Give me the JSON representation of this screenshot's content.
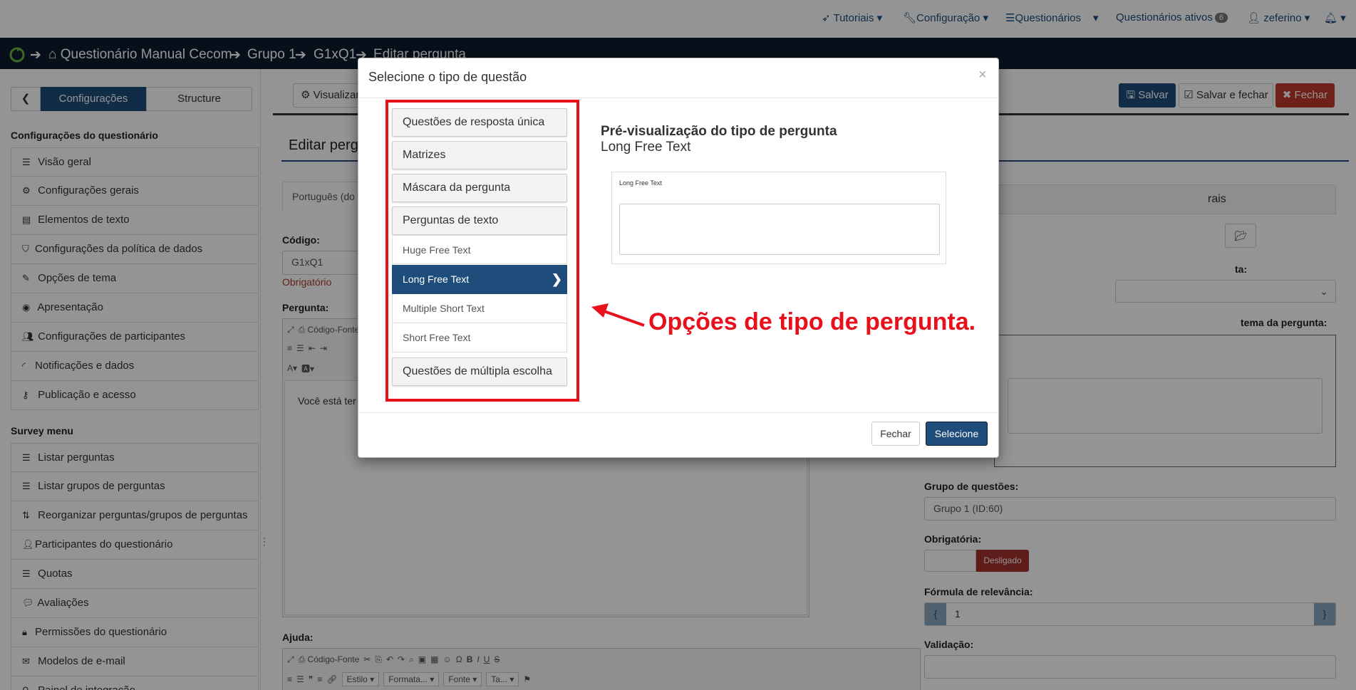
{
  "topnav": {
    "tutorials": "Tutoriais",
    "config": "Configuração",
    "questionnaires": "Questionários",
    "active": "Questionários ativos",
    "active_count": "6",
    "user": "zeferino"
  },
  "breadcrumb": {
    "survey": "Questionário Manual Cecom",
    "group": "Grupo 1",
    "question": "G1xQ1",
    "page": "Editar pergunta"
  },
  "sidebar": {
    "tab_settings": "Configurações",
    "tab_structure": "Structure",
    "section_settings": "Configurações do questionário",
    "items": [
      "Visão geral",
      "Configurações gerais",
      "Elementos de texto",
      "Configurações da política de dados",
      "Opções de tema",
      "Apresentação",
      "Configurações de participantes",
      "Notificações e dados",
      "Publicação e acesso"
    ],
    "section_menu": "Survey menu",
    "menu_items": [
      "Listar perguntas",
      "Listar grupos de perguntas",
      "Reorganizar perguntas/grupos de perguntas",
      "Participantes do questionário",
      "Quotas",
      "Avaliações",
      "Permissões do questionário",
      "Modelos de e-mail",
      "Painel de integração"
    ]
  },
  "main": {
    "preview_btn": "Visualizar",
    "save": "Salvar",
    "save_close": "Salvar e fechar",
    "close": "Fechar",
    "title": "Editar pergunta",
    "lang_tab": "Português (do",
    "code_label": "Código:",
    "code_value": "G1xQ1",
    "required_note": "Obrigatório",
    "question_label": "Pergunta:",
    "source_btn": "Código-Fonte",
    "question_text": "Você está ter",
    "help_label": "Ajuda:",
    "style_select": "Estilo",
    "format_select": "Formata...",
    "font_select": "Fonte",
    "size_select": "Ta...",
    "general_panel": "rais",
    "type_label": "ta:",
    "theme_label": "tema da pergunta:",
    "group_label": "Grupo de questões:",
    "group_value": "Grupo 1 (ID:60)",
    "mandatory_label": "Obrigatória:",
    "mandatory_value": "Desligado",
    "relevance_label": "Fórmula de relevância:",
    "relevance_open": "{",
    "relevance_value": "1",
    "relevance_close": "}",
    "validation_label": "Validação:"
  },
  "modal": {
    "title": "Selecione o tipo de questão",
    "close_x": "×",
    "groups": {
      "single": "Questões de resposta única",
      "matrices": "Matrizes",
      "mask": "Máscara da pergunta",
      "text": "Perguntas de texto",
      "multiple": "Questões de múltipla escolha"
    },
    "text_items": [
      "Huge Free Text",
      "Long Free Text",
      "Multiple Short Text",
      "Short Free Text"
    ],
    "preview_heading": "Pré-visualização do tipo de pergunta",
    "preview_type": "Long Free Text",
    "preview_field_label": "Long Free Text",
    "btn_close": "Fechar",
    "btn_select": "Selecione"
  },
  "annotation": {
    "text": "Opções de tipo de pergunta.",
    "color": "#e8101a"
  },
  "colors": {
    "primary": "#1e4d7b",
    "danger": "#c0392b",
    "navbar": "#0d1d2d",
    "accent_green": "#6ab23e"
  }
}
